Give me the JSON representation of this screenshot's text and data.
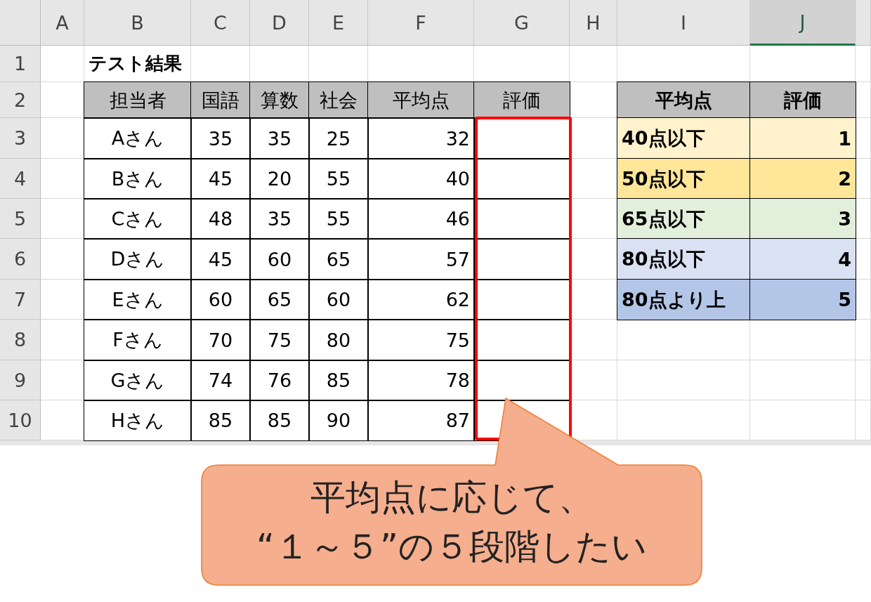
{
  "column_headers": [
    {
      "label": "A",
      "selected": false
    },
    {
      "label": "B",
      "selected": false
    },
    {
      "label": "C",
      "selected": false
    },
    {
      "label": "D",
      "selected": false
    },
    {
      "label": "E",
      "selected": false
    },
    {
      "label": "F",
      "selected": false
    },
    {
      "label": "G",
      "selected": false
    },
    {
      "label": "H",
      "selected": false
    },
    {
      "label": "I",
      "selected": false
    },
    {
      "label": "J",
      "selected": true
    }
  ],
  "row_headers": [
    "1",
    "2",
    "3",
    "4",
    "5",
    "6",
    "7",
    "8",
    "9",
    "10"
  ],
  "title": "テスト結果",
  "score_table": {
    "columns": [
      "担当者",
      "国語",
      "算数",
      "社会",
      "平均点",
      "評価"
    ],
    "rows": [
      [
        "Aさん",
        "35",
        "35",
        "25",
        "32"
      ],
      [
        "Bさん",
        "45",
        "20",
        "55",
        "40"
      ],
      [
        "Cさん",
        "48",
        "35",
        "55",
        "46"
      ],
      [
        "Dさん",
        "45",
        "60",
        "65",
        "57"
      ],
      [
        "Eさん",
        "60",
        "65",
        "60",
        "62"
      ],
      [
        "Fさん",
        "70",
        "75",
        "80",
        "75"
      ],
      [
        "Gさん",
        "74",
        "76",
        "85",
        "78"
      ],
      [
        "Hさん",
        "85",
        "85",
        "90",
        "87"
      ]
    ]
  },
  "grade_table": {
    "columns": [
      "平均点",
      "評価"
    ],
    "rows": [
      {
        "range": "40点以下",
        "grade": "1",
        "color": "#fff2cc"
      },
      {
        "range": "50点以下",
        "grade": "2",
        "color": "#ffe699"
      },
      {
        "range": "65点以下",
        "grade": "3",
        "color": "#e2efda"
      },
      {
        "range": "80点以下",
        "grade": "4",
        "color": "#d9e1f2"
      },
      {
        "range": "80点より上",
        "grade": "5",
        "color": "#b4c6e7"
      }
    ]
  },
  "callout": {
    "lines": [
      "平均点に応じて、",
      "“１～５”の５段階したい"
    ]
  }
}
